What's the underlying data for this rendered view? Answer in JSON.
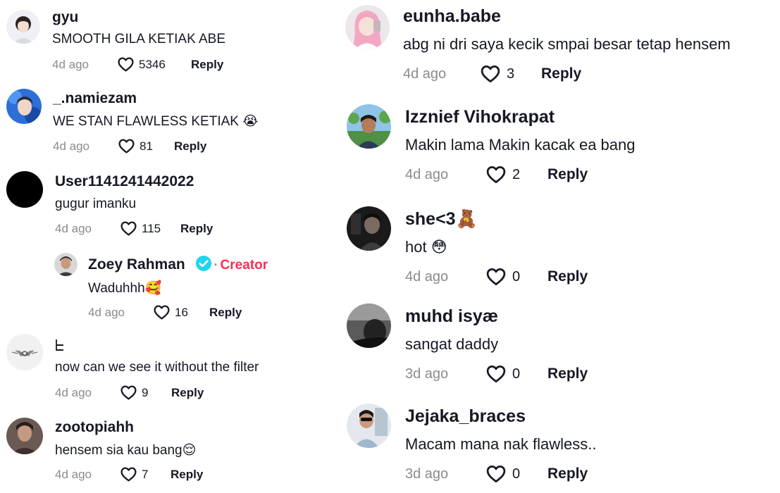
{
  "comments_left": [
    {
      "username": "gyu",
      "text": "SMOOTH GILA KETIAK ABE",
      "time": "4d ago",
      "likes": "5346",
      "reply": "Reply"
    },
    {
      "username": "_.namiezam",
      "text": "WE STAN FLAWLESS KETIAK 😭",
      "time": "4d ago",
      "likes": "81",
      "reply": "Reply"
    },
    {
      "username": "User1141241442022",
      "text": "gugur imanku",
      "time": "4d ago",
      "likes": "115",
      "reply": "Reply"
    },
    {
      "username": "Zoey Rahman",
      "badge": "Creator",
      "text": "Waduhhh🥰",
      "time": "4d ago",
      "likes": "16",
      "reply": "Reply"
    },
    {
      "username": "ᖶ",
      "text": "now can we see it without the filter",
      "time": "4d ago",
      "likes": "9",
      "reply": "Reply"
    },
    {
      "username": "zootopiahh",
      "text": "hensem sia kau bang😌",
      "time": "4d ago",
      "likes": "7",
      "reply": "Reply"
    }
  ],
  "comments_right": [
    {
      "username": "eunha.babe",
      "text": "abg ni dri saya kecik smpai besar tetap hensem",
      "time": "4d ago",
      "likes": "3",
      "reply": "Reply"
    },
    {
      "username": "Izznief Vihokrapat",
      "text": "Makin lama Makin kacak ea bang",
      "time": "4d ago",
      "likes": "2",
      "reply": "Reply"
    },
    {
      "username": "she<3🧸",
      "text": "hot 😳",
      "time": "4d ago",
      "likes": "0",
      "reply": "Reply"
    },
    {
      "username": "muhd isyæ",
      "text": "sangat daddy",
      "time": "3d ago",
      "likes": "0",
      "reply": "Reply"
    },
    {
      "username": "Jejaka_braces",
      "text": "Macam mana nak flawless..",
      "time": "3d ago",
      "likes": "0",
      "reply": "Reply"
    }
  ],
  "colors": {
    "creator": "#fe2c55",
    "verified": "#20d5ec",
    "meta": "#8a8b91",
    "text": "#161823"
  },
  "icons": {
    "like": "heart-outline-icon",
    "verified": "verified-check-icon"
  }
}
